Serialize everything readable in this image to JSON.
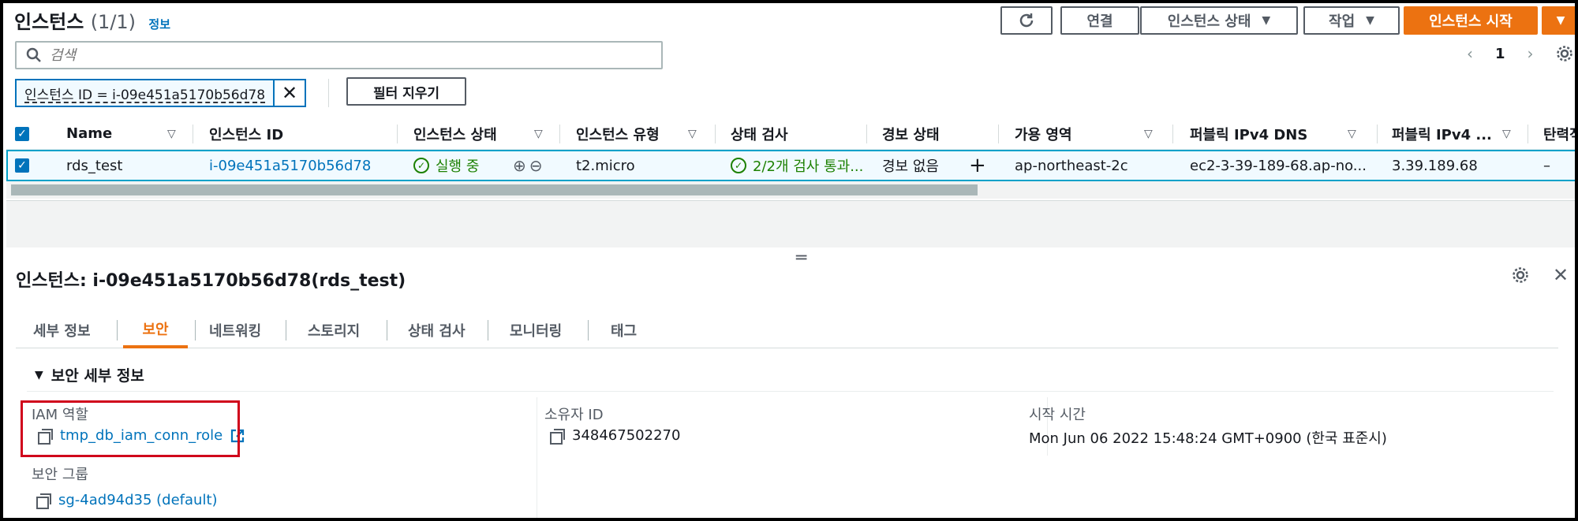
{
  "header": {
    "title": "인스턴스",
    "count": "(1/1)",
    "info": "정보",
    "refresh_icon": "refresh-icon",
    "connect": "연결",
    "instance_state": "인스턴스 상태",
    "actions": "작업",
    "launch": "인스턴스 시작"
  },
  "search": {
    "placeholder": "검색"
  },
  "pager": {
    "prev": "‹",
    "page": "1",
    "next": "›"
  },
  "filter": {
    "token": "인스턴스 ID = i-09e451a5170b56d78",
    "clear": "필터 지우기"
  },
  "table": {
    "columns": [
      "Name",
      "인스턴스 ID",
      "인스턴스 상태",
      "인스턴스 유형",
      "상태 검사",
      "경보 상태",
      "가용 영역",
      "퍼블릭 IPv4 DNS",
      "퍼블릭 IPv4 ...",
      "탄력적"
    ],
    "row": {
      "name": "rds_test",
      "instance_id": "i-09e451a5170b56d78",
      "state": "실행 중",
      "type": "t2.micro",
      "status_check": "2/2개 검사 통과...",
      "alarm": "경보 없음",
      "az": "ap-northeast-2c",
      "dns": "ec2-3-39-189-68.ap-no...",
      "ipv4": "3.39.189.68",
      "elastic": "–"
    }
  },
  "details": {
    "title": "인스턴스: i-09e451a5170b56d78(rds_test)",
    "tabs": [
      "세부 정보",
      "보안",
      "네트워킹",
      "스토리지",
      "상태 검사",
      "모니터링",
      "태그"
    ],
    "section": "보안 세부 정보",
    "iam_label": "IAM 역할",
    "iam_value": "tmp_db_iam_conn_role",
    "owner_label": "소유자 ID",
    "owner_value": "348467502270",
    "launch_label": "시작 시간",
    "launch_value": "Mon Jun 06 2022 15:48:24 GMT+0900 (한국 표준시)",
    "sg_label": "보안 그룹",
    "sg_value": "sg-4ad94d35 (default)"
  },
  "colors": {
    "accent": "#ec7211",
    "link": "#0073bb",
    "ok": "#1d8102",
    "highlight": "#d0021b"
  }
}
